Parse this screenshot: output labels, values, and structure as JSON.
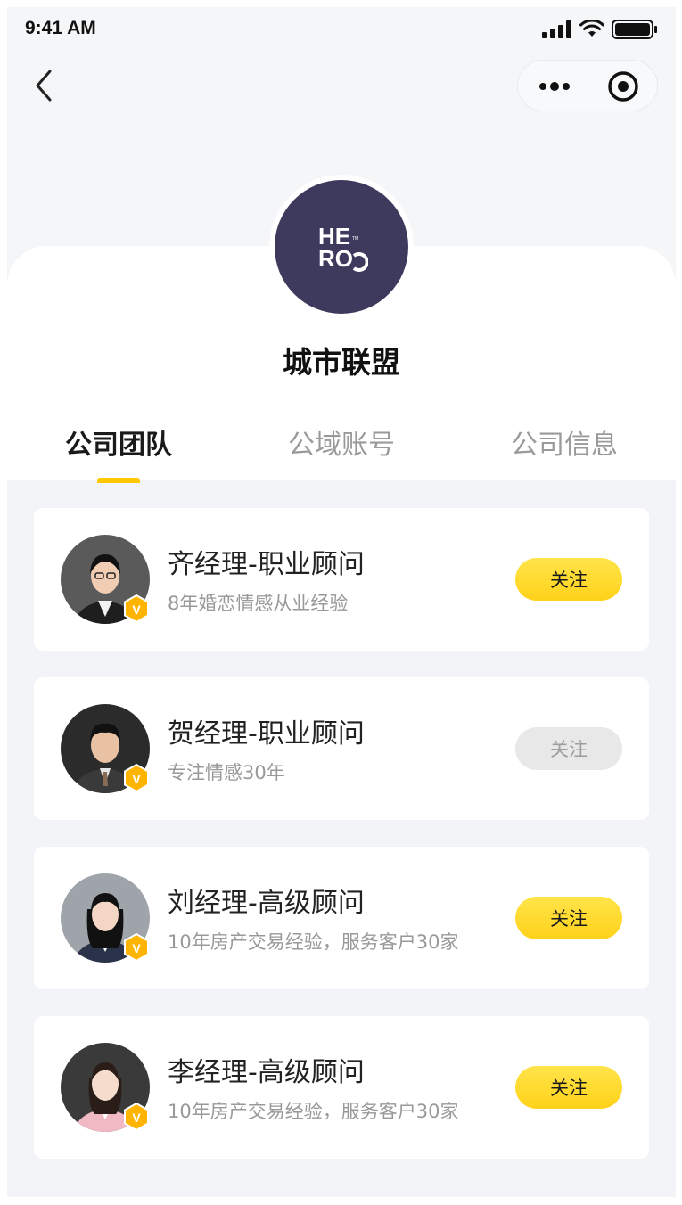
{
  "status_bar": {
    "time": "9:41 AM"
  },
  "header": {
    "company_name": "城市联盟",
    "logo_text_top": "HE",
    "logo_text_bottom": "RO",
    "logo_tm": "TM"
  },
  "tabs": [
    {
      "label": "公司团队",
      "active": true
    },
    {
      "label": "公域账号",
      "active": false
    },
    {
      "label": "公司信息",
      "active": false
    }
  ],
  "colors": {
    "accent": "#ffd21a",
    "logo_bg": "#3d3a5e",
    "page_bg": "#f2f4f7"
  },
  "members": [
    {
      "name": "齐经理-职业顾问",
      "desc": "8年婚恋情感从业经验",
      "follow_label": "关注",
      "followed": false
    },
    {
      "name": "贺经理-职业顾问",
      "desc": "专注情感30年",
      "follow_label": "关注",
      "followed": true
    },
    {
      "name": "刘经理-高级顾问",
      "desc": "10年房产交易经验，服务客户30家",
      "follow_label": "关注",
      "followed": false
    },
    {
      "name": "李经理-高级顾问",
      "desc": "10年房产交易经验，服务客户30家",
      "follow_label": "关注",
      "followed": false
    }
  ],
  "badge_letter": "V"
}
